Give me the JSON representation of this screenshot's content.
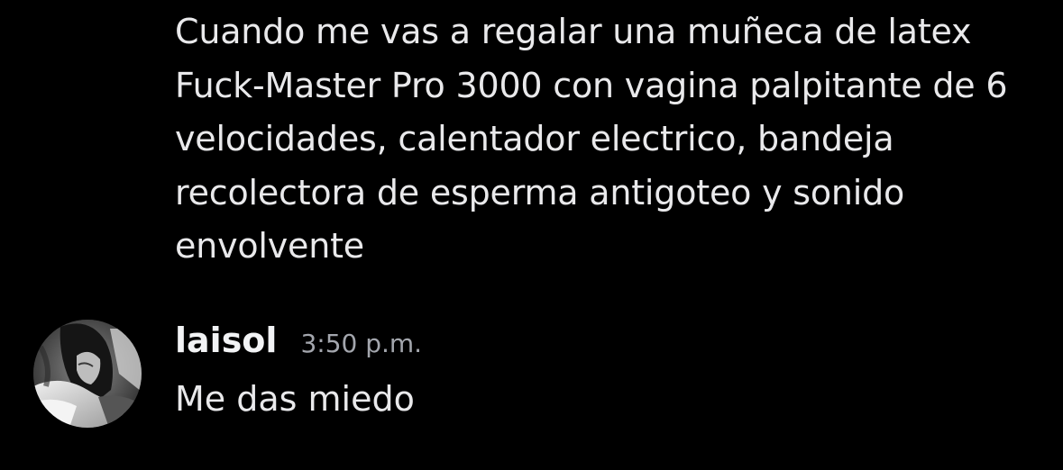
{
  "messages": [
    {
      "text": "Cuando me vas a regalar una muñeca de latex\nFuck-Master Pro 3000 con vagina palpitante de 6\nvelocidades, calentador electrico, bandeja\nrecolectora de esperma antigoteo y sonido\nenvolvente"
    },
    {
      "username": "laisol",
      "timestamp": "3:50 p.m.",
      "text": "Me das miedo",
      "avatar_icon": "user-avatar-image"
    }
  ],
  "colors": {
    "background": "#000000",
    "message_text": "#e9e9eb",
    "username": "#f2f3f5",
    "timestamp": "#a3a6ad"
  }
}
